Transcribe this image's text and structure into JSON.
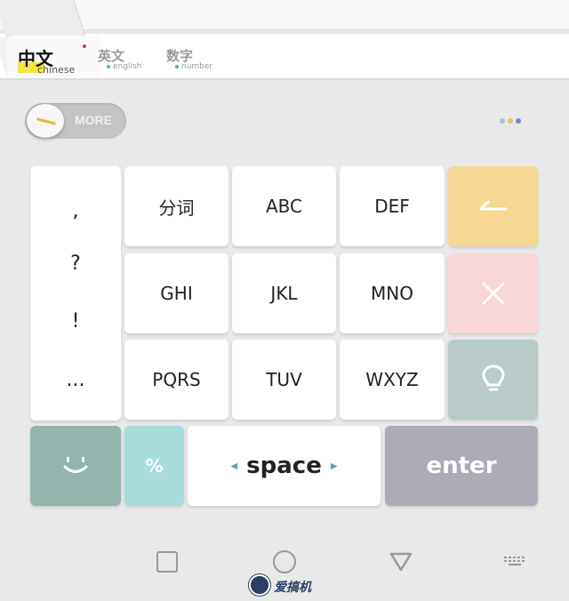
{
  "tabs": [
    {
      "main": "中文",
      "sub": "chinese"
    },
    {
      "main": "英文",
      "sub": "english"
    },
    {
      "main": "数字",
      "sub": "number"
    }
  ],
  "toggle": {
    "label": "MORE"
  },
  "menu_dots_colors": [
    "#a9c3c7",
    "#e9c36a",
    "#6f8fc4"
  ],
  "punctuation": [
    ",",
    "?",
    "!",
    "..."
  ],
  "keys": {
    "row1": [
      "分词",
      "ABC",
      "DEF"
    ],
    "row2": [
      "GHI",
      "JKL",
      "MNO"
    ],
    "row3": [
      "PQRS",
      "TUV",
      "WXYZ"
    ],
    "symbol": "%",
    "space": "space",
    "enter": "enter"
  },
  "icons": {
    "backspace": "backspace-arrow-icon",
    "clear": "close-icon",
    "idea": "lightbulb-icon",
    "emoji": "smiley-icon",
    "nav_recent": "square-icon",
    "nav_home": "circle-icon",
    "nav_back": "triangle-icon",
    "keyboard": "keyboard-icon"
  },
  "colors": {
    "backspace_key": "#f7d892",
    "clear_key": "#f9d7d7",
    "idea_key": "#b9cbc8",
    "emoji_key": "#94b5ad",
    "symbol_key": "#a8dcdd",
    "enter_key": "#acacb8",
    "space_arrows": "#5aa7b8"
  },
  "watermark": {
    "text": "爱搞机"
  }
}
